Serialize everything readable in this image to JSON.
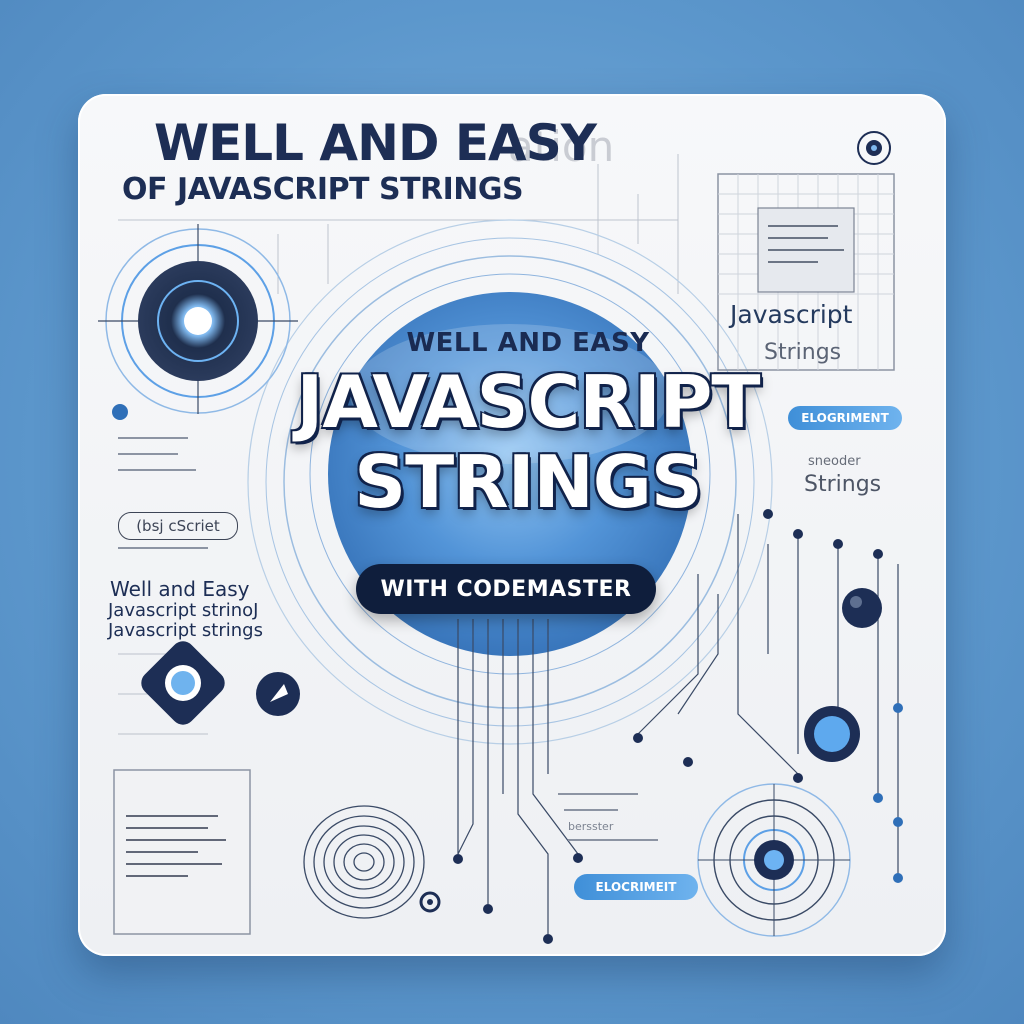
{
  "header": {
    "title": "WELL AND EASY",
    "subtitle": "OF JAVASCRIPT STRINGS",
    "faint_text": "ation"
  },
  "hero": {
    "kicker": "WELL AND EASY",
    "line1": "JAVASCRIPT",
    "line2": "STRINGS",
    "pill": "WITH CODEMASTER"
  },
  "right_panel": {
    "label_js": "Javascript",
    "label_strings": "Strings",
    "button_1": "ELOGRIMENT",
    "small_text": "sneoder",
    "side_strings": "Strings"
  },
  "left_panel": {
    "script_chip": "(bsj cScriet",
    "well": "Well and Easy",
    "js_1": "Javascript strinoJ",
    "js_2": "Javascript strings"
  },
  "bottom": {
    "button_2": "ELOCRIMEIT",
    "faint_1": "bersster"
  },
  "colors": {
    "background": "#5c97cc",
    "card": "#f3f4f6",
    "navy": "#1d2e55",
    "accent_blue": "#3f8fd8"
  }
}
